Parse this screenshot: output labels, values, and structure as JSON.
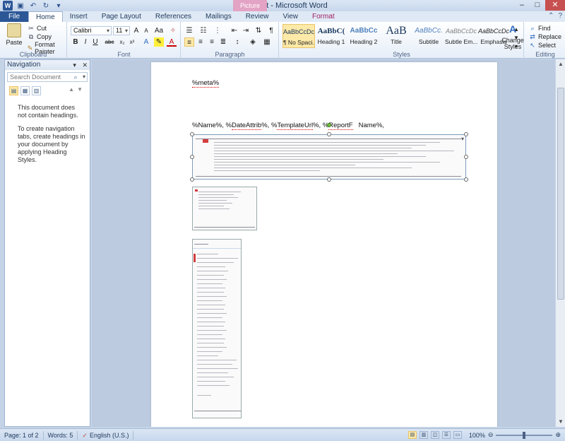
{
  "titlebar": {
    "title": "Doc8.odt - Microsoft Word",
    "context_tab": "Picture Tools"
  },
  "tabs": [
    {
      "label": "File"
    },
    {
      "label": "Home"
    },
    {
      "label": "Insert"
    },
    {
      "label": "Page Layout"
    },
    {
      "label": "References"
    },
    {
      "label": "Mailings"
    },
    {
      "label": "Review"
    },
    {
      "label": "View"
    },
    {
      "label": "Format"
    }
  ],
  "ribbon": {
    "clipboard": {
      "label": "Clipboard",
      "paste": "Paste",
      "cut": "Cut",
      "copy": "Copy",
      "format_painter": "Format Painter"
    },
    "font": {
      "label": "Font",
      "family": "Calibri",
      "size": "11"
    },
    "paragraph": {
      "label": "Paragraph"
    },
    "styles": {
      "label": "Styles",
      "items": [
        {
          "preview": "AaBbCcDc",
          "name": "¶ No Spaci..."
        },
        {
          "preview": "AaBbC(",
          "name": "Heading 1"
        },
        {
          "preview": "AaBbCc",
          "name": "Heading 2"
        },
        {
          "preview": "AaB",
          "name": "Title"
        },
        {
          "preview": "AaBbCc.",
          "name": "Subtitle"
        },
        {
          "preview": "AaBbCcDc",
          "name": "Subtle Em..."
        },
        {
          "preview": "AaBbCcDc",
          "name": "Emphasis"
        }
      ],
      "change_styles": "Change Styles"
    },
    "editing": {
      "label": "Editing",
      "find": "Find",
      "replace": "Replace",
      "select": "Select"
    }
  },
  "nav": {
    "title": "Navigation",
    "search_placeholder": "Search Document",
    "message1": "This document does not contain headings.",
    "message2": "To create navigation tabs, create headings in your document by applying Heading Styles."
  },
  "doc": {
    "line1": "%meta%",
    "line2_parts": [
      "%Name%, %",
      "DateAttrib",
      "%, %",
      "TemplateUrl",
      "%, %",
      "ReportF",
      "",
      "Name%,"
    ]
  },
  "status": {
    "page": "Page: 1 of 2",
    "words": "Words: 5",
    "language": "English (U.S.)",
    "zoom": "100%"
  }
}
